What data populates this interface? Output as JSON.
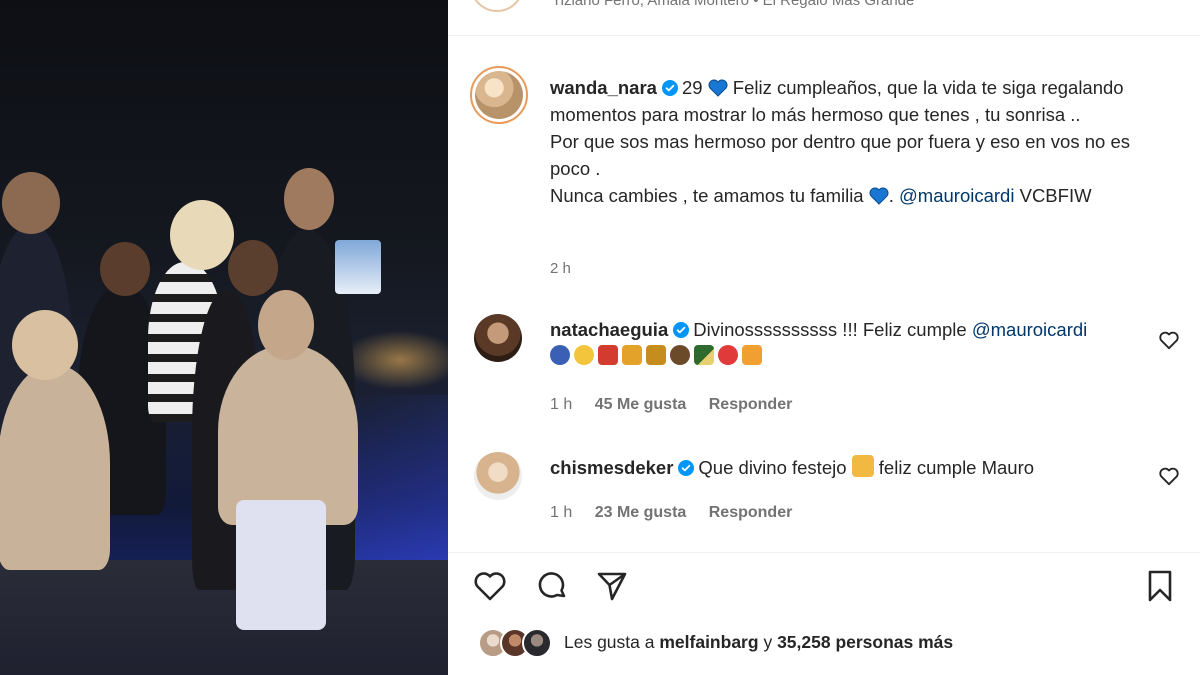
{
  "top_strip": {
    "music": "Tiziano Ferro, Amaia Montero • El Regalo Más Grande"
  },
  "caption": {
    "username": "wanda_nara",
    "text_part1": "29",
    "text_part2": "Feliz cumpleaños, que la vida te siga regalando momentos para mostrar lo más hermoso que tenes , tu sonrisa ..",
    "text_part3": "Por que sos mas hermoso por dentro que por fuera y eso en vos no es poco .",
    "text_part4_a": "Nunca cambies , te amamos tu familia",
    "text_part4_b": ".",
    "mention": "@mauroicardi",
    "tag": "VCBFIW",
    "time_ago": "2 h"
  },
  "comments": [
    {
      "username": "natachaeguia",
      "text": "Divinossssssssss !!! Feliz cumple",
      "mention": "@mauroicardi",
      "time": "1 h",
      "likes": "45 Me gusta",
      "reply": "Responder"
    },
    {
      "username": "chismesdeker",
      "text_a": "Que divino festejo",
      "text_b": "feliz cumple Mauro",
      "time": "1 h",
      "likes": "23 Me gusta",
      "reply": "Responder"
    }
  ],
  "likes": {
    "prefix": "Les gusta a",
    "user": "melfainbarg",
    "connector": "y",
    "count": "35,258 personas más"
  },
  "colors": {
    "verified_blue": "#0095f6",
    "mention_blue": "#00376b",
    "secondary_text": "#737373",
    "heart_blue": "#1877d2"
  },
  "icons": [
    "heart-icon",
    "comment-icon",
    "share-icon",
    "bookmark-icon",
    "verified-badge-icon",
    "blue-heart-emoji"
  ]
}
